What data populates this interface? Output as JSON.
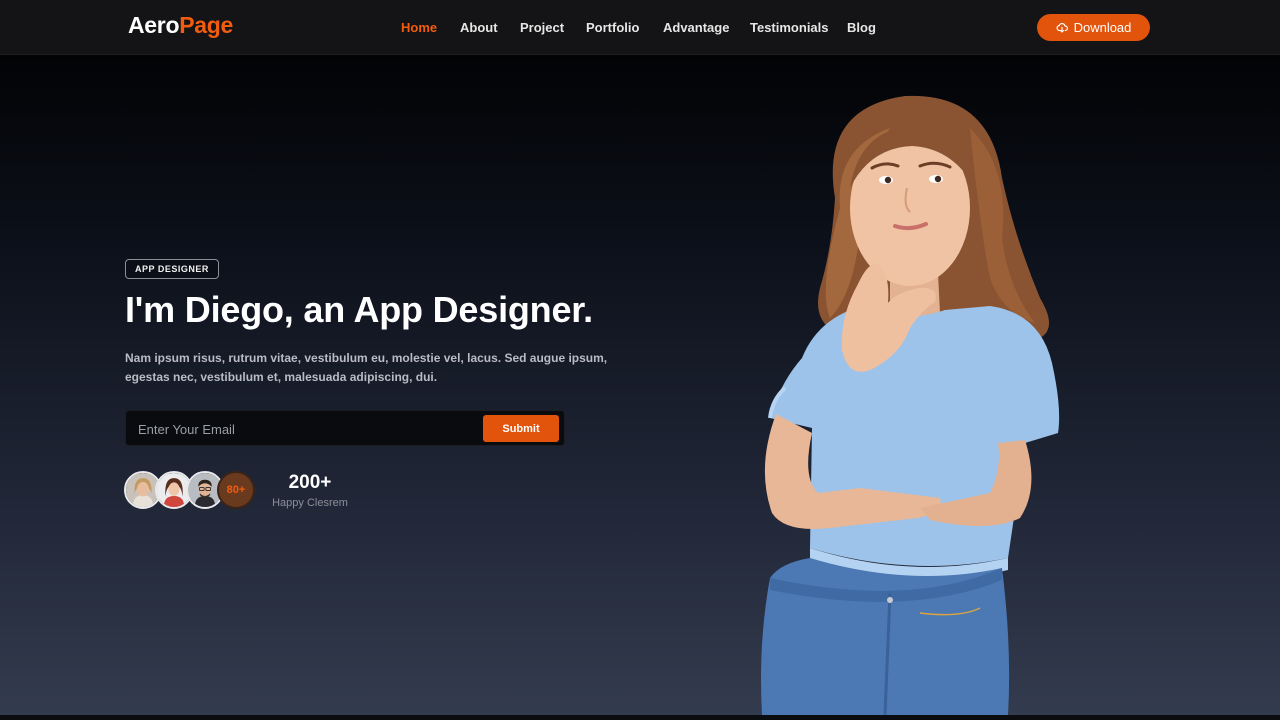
{
  "brand": {
    "logo_main": "Aero",
    "logo_accent": "Page"
  },
  "nav": {
    "items": [
      {
        "label": "Home",
        "active": true
      },
      {
        "label": "About"
      },
      {
        "label": "Project"
      },
      {
        "label": "Portfolio"
      },
      {
        "label": "Advantage"
      },
      {
        "label": "Testimonials"
      },
      {
        "label": "Blog"
      }
    ],
    "download_label": "Download",
    "download_icon": "cloud-download-icon"
  },
  "hero": {
    "tag": "APP DESIGNER",
    "title": "I'm Diego, an App Designer.",
    "description": "Nam ipsum risus, rutrum vitae, vestibulum eu, molestie vel, lacus. Sed augue ipsum, egestas nec, vestibulum et, malesuada adipiscing, dui.",
    "email_placeholder": "Enter Your Email",
    "submit_label": "Submit",
    "avatars_more": "80+",
    "stat_value": "200+",
    "stat_label": "Happy Clesrem"
  },
  "colors": {
    "accent": "#e2530c",
    "header_bg": "#141416",
    "hero_top": "#020305",
    "hero_bottom": "#333b4e"
  }
}
